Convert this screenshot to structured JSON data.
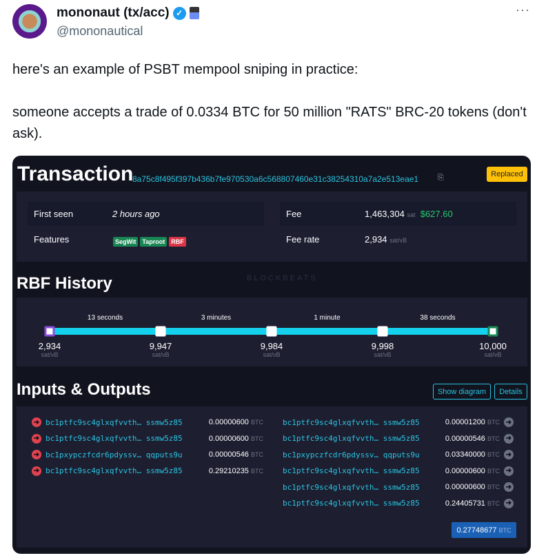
{
  "tweet": {
    "author_name": "mononaut (tx/acc)",
    "handle": "@mononautical",
    "more_icon": "ellipsis-icon",
    "verified_icon": "verified-badge-icon",
    "text_line1": "here's an example of PSBT mempool sniping in practice:",
    "text_line2": "someone accepts a trade of 0.0334 BTC for 50 million \"RATS\" BRC-20 tokens (don't ask)."
  },
  "screenshot": {
    "title": "Transaction",
    "txid": "8a75c8f495f397b436b7fe970530a6c568807460e31c38254310a7a2e513eae1",
    "status": "Replaced",
    "first_seen_label": "First seen",
    "first_seen": "2 hours ago",
    "features_label": "Features",
    "features": [
      "SegWit",
      "Taproot",
      "RBF"
    ],
    "fee_label": "Fee",
    "fee_sat": "1,463,304",
    "fee_unit": "sat",
    "fee_usd": "$627.60",
    "fee_rate_label": "Fee rate",
    "fee_rate": "2,934",
    "fee_rate_unit": "sat/vB",
    "watermark": "BLOCKBEATS",
    "rbf_title": "RBF History",
    "rbf": {
      "intervals": [
        "13 seconds",
        "3 minutes",
        "1 minute",
        "38 seconds"
      ],
      "rates": [
        "2,934",
        "9,947",
        "9,984",
        "9,998",
        "10,000"
      ],
      "unit": "sat/vB"
    },
    "io_title": "Inputs & Outputs",
    "show_diagram": "Show diagram",
    "details": "Details",
    "btc": "BTC",
    "inputs": [
      {
        "address": "bc1ptfc9sc4glxqfvvth… ssmw5z85",
        "amount": "0.00000600"
      },
      {
        "address": "bc1ptfc9sc4glxqfvvth… ssmw5z85",
        "amount": "0.00000600"
      },
      {
        "address": "bc1pxypczfcdr6pdyssv… qqputs9u",
        "amount": "0.00000546"
      },
      {
        "address": "bc1ptfc9sc4glxqfvvth… ssmw5z85",
        "amount": "0.29210235"
      }
    ],
    "outputs": [
      {
        "address": "bc1ptfc9sc4glxqfvvth… ssmw5z85",
        "amount": "0.00001200"
      },
      {
        "address": "bc1ptfc9sc4glxqfvvth… ssmw5z85",
        "amount": "0.00000546"
      },
      {
        "address": "bc1pxypczfcdr6pdyssv… qqputs9u",
        "amount": "0.03340000"
      },
      {
        "address": "bc1ptfc9sc4glxqfvvth… ssmw5z85",
        "amount": "0.00000600"
      },
      {
        "address": "bc1ptfc9sc4glxqfvvth… ssmw5z85",
        "amount": "0.00000600"
      },
      {
        "address": "bc1ptfc9sc4glxqfvvth… ssmw5z85",
        "amount": "0.24405731"
      }
    ],
    "total": "0.27748677",
    "colors": {
      "accent": "#2bc4e0",
      "replaced": "#ffc107",
      "segwit": "#198754",
      "rbf": "#dc3545",
      "input_icon": "#e0424f",
      "total": "#1a60b5"
    }
  }
}
